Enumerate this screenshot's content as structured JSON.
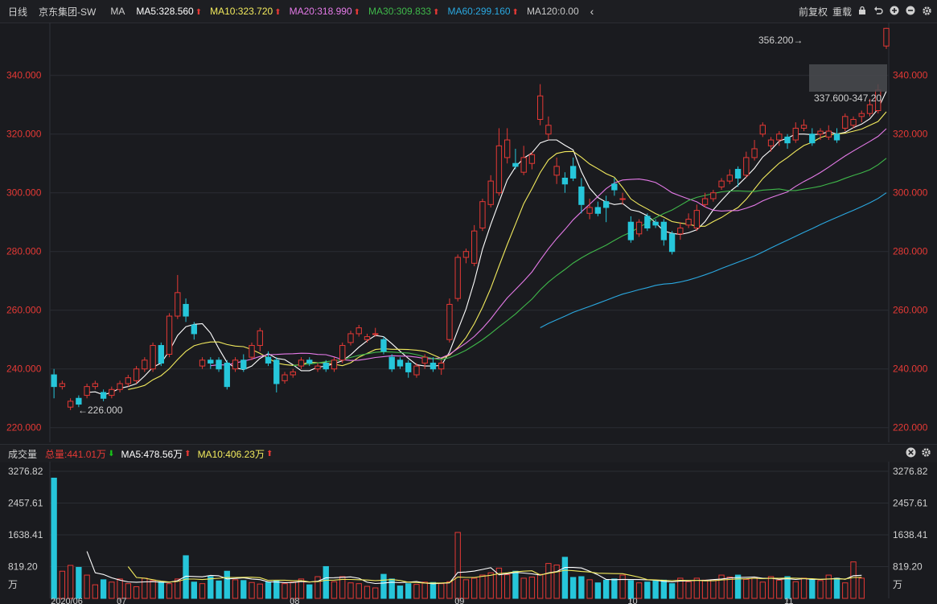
{
  "header": {
    "period": "日线",
    "stock": "京东集团-SW",
    "ma_label": "MA",
    "ma": [
      {
        "label": "MA5:328.560",
        "color": "#ffffff"
      },
      {
        "label": "MA10:323.720",
        "color": "#f2ea5d"
      },
      {
        "label": "MA20:318.990",
        "color": "#e57ae8"
      },
      {
        "label": "MA30:309.833",
        "color": "#3fb84a"
      },
      {
        "label": "MA60:299.160",
        "color": "#2aa8e0"
      },
      {
        "label": "MA120:0.00",
        "color": "#e0e0e0"
      }
    ],
    "controls": [
      "前复权",
      "重载"
    ],
    "icons": [
      "lock-icon",
      "undo-icon",
      "zoom-in-icon",
      "zoom-out-icon",
      "settings-icon"
    ]
  },
  "volume_header": {
    "title": "成交量",
    "total": "总量:441.01万",
    "ma5": "MA5:478.56万",
    "ma10": "MA10:406.23万"
  },
  "colors": {
    "up": "#e53935",
    "down": "#26c6da",
    "grid": "#2a2d33",
    "bg": "#1a1b1f"
  },
  "chart_data": [
    {
      "type": "candlestick",
      "ylim": [
        215,
        358
      ],
      "price_ticks": [
        "340.000",
        "320.000",
        "300.000",
        "280.000",
        "260.000",
        "240.000",
        "220.000"
      ],
      "tick_values": [
        340,
        320,
        300,
        280,
        260,
        240,
        220
      ],
      "x_labels": [
        "2020/06",
        "07",
        "08",
        "09",
        "10",
        "11"
      ],
      "x_label_index": [
        0,
        8,
        29,
        49,
        70,
        89
      ],
      "annotations": {
        "high": "356.200→",
        "low": "←226.000",
        "range": "337.600-347.20"
      },
      "candles": [
        [
          238,
          234,
          240,
          230
        ],
        [
          234,
          235,
          236,
          233
        ],
        [
          227,
          229,
          230,
          226
        ],
        [
          230,
          228,
          231,
          227
        ],
        [
          231,
          234,
          235,
          230
        ],
        [
          234,
          235,
          236,
          233
        ],
        [
          232,
          230,
          233,
          229
        ],
        [
          231,
          233,
          234,
          230
        ],
        [
          233,
          235,
          236,
          232
        ],
        [
          235,
          237,
          238,
          234
        ],
        [
          236,
          240,
          241,
          235
        ],
        [
          240,
          243,
          244,
          239
        ],
        [
          240,
          248,
          249,
          239
        ],
        [
          248,
          242,
          249,
          241
        ],
        [
          245,
          258,
          259,
          244
        ],
        [
          258,
          266,
          272,
          257
        ],
        [
          262,
          258,
          264,
          256
        ],
        [
          255,
          252,
          256,
          250
        ],
        [
          241,
          243,
          244,
          240
        ],
        [
          243,
          242,
          244,
          240
        ],
        [
          243,
          240,
          244,
          239
        ],
        [
          242,
          234,
          243,
          233
        ],
        [
          240,
          243,
          244,
          239
        ],
        [
          243,
          240,
          245,
          239
        ],
        [
          244,
          248,
          249,
          243
        ],
        [
          248,
          253,
          254,
          246
        ],
        [
          244,
          242,
          246,
          241
        ],
        [
          243,
          235,
          244,
          232
        ],
        [
          236,
          238,
          239,
          235
        ],
        [
          238,
          239,
          240,
          237
        ],
        [
          241,
          243,
          244,
          240
        ],
        [
          243,
          242,
          244,
          241
        ],
        [
          240,
          241,
          242,
          239
        ],
        [
          242,
          240,
          243,
          239
        ],
        [
          240,
          243,
          244,
          239
        ],
        [
          243,
          248,
          249,
          242
        ],
        [
          249,
          252,
          253,
          248
        ],
        [
          252,
          254,
          255,
          251
        ],
        [
          250,
          251,
          252,
          249
        ],
        [
          252,
          252,
          254,
          251
        ],
        [
          250,
          246,
          251,
          245
        ],
        [
          244,
          240,
          245,
          239
        ],
        [
          243,
          241,
          244,
          240
        ],
        [
          242,
          239,
          243,
          237
        ],
        [
          238,
          241,
          242,
          237
        ],
        [
          242,
          244,
          245,
          240
        ],
        [
          242,
          240,
          244,
          239
        ],
        [
          240,
          242,
          243,
          238
        ],
        [
          250,
          262,
          264,
          249
        ],
        [
          264,
          278,
          279,
          263
        ],
        [
          278,
          280,
          281,
          276
        ],
        [
          276,
          287,
          289,
          275
        ],
        [
          288,
          297,
          298,
          287
        ],
        [
          296,
          304,
          306,
          295
        ],
        [
          300,
          316,
          322,
          299
        ],
        [
          312,
          318,
          322,
          310
        ],
        [
          310,
          309,
          315,
          308
        ],
        [
          307,
          312,
          316,
          306
        ],
        [
          310,
          313,
          314,
          308
        ],
        [
          325,
          333,
          337,
          323
        ],
        [
          320,
          323,
          326,
          318
        ],
        [
          306,
          309,
          312,
          303
        ],
        [
          305,
          303,
          307,
          300
        ],
        [
          309,
          305,
          312,
          304
        ],
        [
          302,
          296,
          305,
          293
        ],
        [
          293,
          295,
          298,
          291
        ],
        [
          295,
          293,
          297,
          292
        ],
        [
          297,
          295,
          299,
          290
        ],
        [
          303,
          301,
          305,
          299
        ],
        [
          298,
          298,
          300,
          296
        ],
        [
          290,
          284,
          292,
          283
        ],
        [
          286,
          290,
          291,
          285
        ],
        [
          292,
          288,
          293,
          287
        ],
        [
          290,
          289,
          291,
          288
        ],
        [
          290,
          284,
          291,
          282
        ],
        [
          286,
          280,
          287,
          279
        ],
        [
          286,
          288,
          290,
          284
        ],
        [
          289,
          291,
          293,
          288
        ],
        [
          288,
          294,
          296,
          287
        ],
        [
          296,
          298,
          300,
          295
        ],
        [
          298,
          300,
          301,
          297
        ],
        [
          302,
          304,
          305,
          301
        ],
        [
          304,
          306,
          308,
          303
        ],
        [
          308,
          305,
          309,
          302
        ],
        [
          306,
          312,
          314,
          305
        ],
        [
          312,
          315,
          318,
          311
        ],
        [
          320,
          323,
          324,
          319
        ],
        [
          316,
          318,
          319,
          314
        ],
        [
          318,
          320,
          321,
          316
        ],
        [
          319,
          317,
          320,
          315
        ],
        [
          318,
          322,
          324,
          317
        ],
        [
          322,
          323,
          325,
          321
        ],
        [
          320,
          317,
          322,
          316
        ],
        [
          320,
          321,
          322,
          318
        ],
        [
          319,
          321,
          323,
          318
        ],
        [
          320,
          318,
          322,
          317
        ],
        [
          322,
          326,
          327,
          321
        ],
        [
          323,
          325,
          326,
          322
        ],
        [
          326,
          327,
          328,
          324
        ],
        [
          327,
          330,
          332,
          326
        ],
        [
          328,
          335,
          337,
          327
        ],
        [
          350,
          356,
          356.2,
          349
        ]
      ],
      "ma_lines": [
        {
          "name": "MA5",
          "color": "#ffffff"
        },
        {
          "name": "MA10",
          "color": "#f2ea5d"
        },
        {
          "name": "MA20",
          "color": "#e57ae8"
        },
        {
          "name": "MA30",
          "color": "#3fb84a"
        },
        {
          "name": "MA60",
          "color": "#2aa8e0"
        }
      ]
    },
    {
      "type": "bar",
      "title": "成交量",
      "ylim": [
        0,
        3400
      ],
      "ticks": [
        "3276.82",
        "2457.61",
        "1638.41",
        "819.20",
        "万"
      ],
      "tick_values": [
        3276.82,
        2457.61,
        1638.41,
        819.2,
        0
      ],
      "values": [
        3100,
        700,
        850,
        800,
        600,
        350,
        480,
        420,
        500,
        380,
        300,
        520,
        460,
        420,
        380,
        500,
        1100,
        420,
        380,
        560,
        450,
        700,
        480,
        460,
        410,
        370,
        420,
        450,
        380,
        420,
        500,
        350,
        560,
        820,
        430,
        560,
        400,
        380,
        310,
        270,
        620,
        500,
        320,
        380,
        360,
        420,
        410,
        380,
        430,
        1700,
        480,
        520,
        600,
        660,
        780,
        610,
        700,
        520,
        550,
        620,
        900,
        860,
        1060,
        540,
        560,
        480,
        400,
        470,
        500,
        600,
        460,
        400,
        420,
        450,
        470,
        380,
        520,
        430,
        520,
        470,
        480,
        600,
        550,
        600,
        490,
        520,
        420,
        560,
        470,
        560,
        430,
        520,
        480,
        460,
        600,
        520,
        400,
        940,
        520
      ]
    }
  ]
}
